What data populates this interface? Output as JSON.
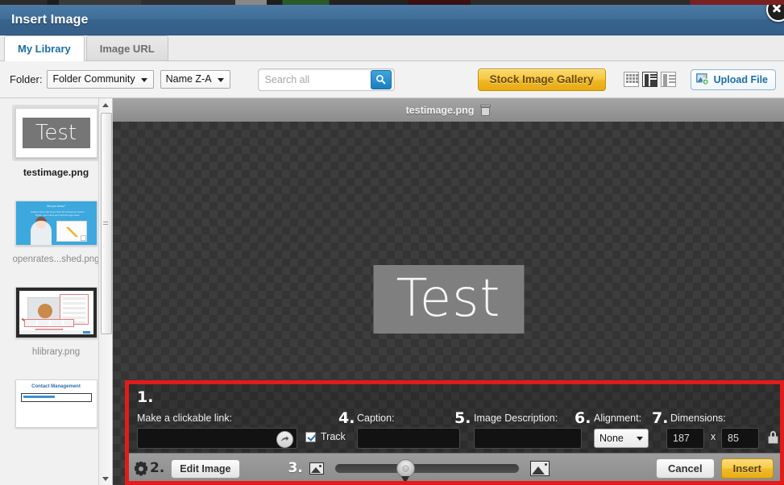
{
  "dialog": {
    "title": "Insert Image",
    "close_label": "×"
  },
  "tabs": [
    {
      "label": "My Library",
      "active": true
    },
    {
      "label": "Image URL",
      "active": false
    }
  ],
  "toolbar": {
    "folder_label": "Folder:",
    "folder_value": "Folder Community",
    "sort_value": "Name Z-A",
    "search_placeholder": "Search all",
    "search_value": "",
    "search_icon": "magnifier-icon",
    "gallery_button": "Stock Image Gallery",
    "view_modes": [
      {
        "name": "grid-view",
        "active": false
      },
      {
        "name": "detail-view",
        "active": true
      },
      {
        "name": "list-view",
        "active": false
      }
    ],
    "upload_button": "Upload File",
    "upload_icon": "upload-image-icon"
  },
  "sidebar": {
    "thumbnails": [
      {
        "caption": "testimage.png",
        "selected": true,
        "preview_text": "Test"
      },
      {
        "caption": "openrates...shed.png",
        "selected": false
      },
      {
        "caption": "hlibrary.png",
        "selected": false
      },
      {
        "caption": "Contact Management",
        "selected": false
      }
    ],
    "scroll_up_icon": "scroll-up-arrow",
    "scroll_down_icon": "scroll-down-arrow"
  },
  "preview": {
    "filename": "testimage.png",
    "delete_icon": "trash-icon",
    "image_text": "Test"
  },
  "options": {
    "steps": {
      "one": "1.",
      "two": "2.",
      "three": "3.",
      "four": "4.",
      "five": "5.",
      "six": "6.",
      "seven": "7."
    },
    "link_label": "Make a clickable link:",
    "link_value": "",
    "link_go_icon": "go-arrow-icon",
    "track_label": "Track",
    "track_checked": true,
    "caption_label": "Caption:",
    "caption_value": "",
    "description_label": "Image Description:",
    "description_value": "",
    "alignment_label": "Alignment:",
    "alignment_value": "None",
    "dimensions_label": "Dimensions:",
    "width_value": "187",
    "dimension_separator": "x",
    "height_value": "85",
    "lock_icon": "lock-aspect-ratio-icon",
    "highlight_color": "#e21b1b"
  },
  "actions": {
    "settings_icon": "gear-icon",
    "edit_image_button": "Edit Image",
    "small_image_icon": "small-image-icon",
    "large_image_icon": "large-image-icon",
    "zoom_slider_value": 50,
    "cancel_button": "Cancel",
    "insert_button": "Insert"
  }
}
